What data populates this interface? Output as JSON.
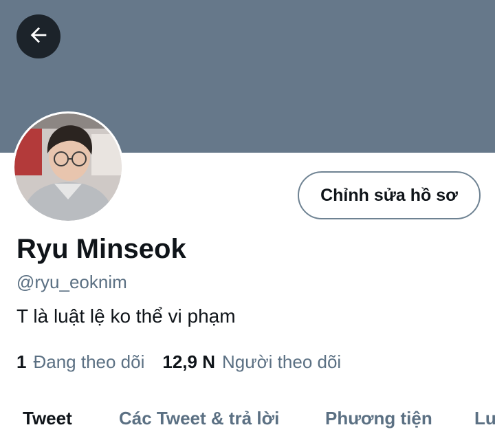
{
  "header": {
    "back_icon": "arrow-left-icon",
    "banner_color": "#66788a"
  },
  "profile": {
    "name": "Ryu Minseok",
    "handle": "@ryu_eoknim",
    "bio": "T là luật lệ ko thể vi phạm",
    "edit_button_label": "Chỉnh sửa hồ sơ"
  },
  "stats": {
    "following_count": "1",
    "following_label": "Đang theo dõi",
    "followers_count": "12,9 N",
    "followers_label": "Người theo dõi"
  },
  "tabs": [
    {
      "label": "Tweet",
      "active": true
    },
    {
      "label": "Các Tweet & trả lời",
      "active": false
    },
    {
      "label": "Phương tiện",
      "active": false
    },
    {
      "label": "Lượt thích",
      "active": false
    }
  ],
  "colors": {
    "primary_text": "#0f1419",
    "secondary_text": "#5b7083",
    "button_border": "#6e8292"
  }
}
